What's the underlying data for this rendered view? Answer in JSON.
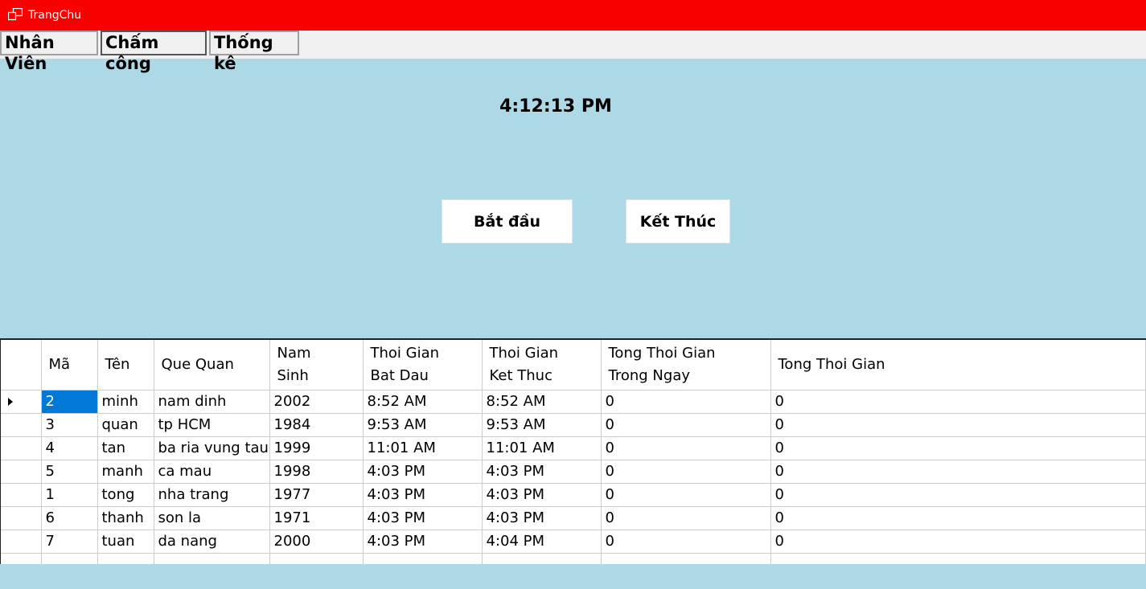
{
  "window": {
    "title": "TrangChu",
    "titlebar_color": "#F80000",
    "background_color": "#ADD8E6"
  },
  "menu": {
    "items": [
      "Nhân Viên",
      "Chấm công",
      "Thống kê"
    ],
    "active_index": 1
  },
  "clock": {
    "time": "4:12:13 PM"
  },
  "buttons": {
    "start_label": "Bắt đầu",
    "end_label": "Kết Thúc"
  },
  "grid": {
    "columns": [
      "Mã",
      "Tên",
      "Que Quan",
      "Nam Sinh",
      "Thoi Gian Bat Dau",
      "Thoi Gian Ket Thuc",
      "Tong Thoi Gian Trong Ngay",
      "Tong Thoi Gian"
    ],
    "rows": [
      [
        "2",
        "minh",
        "nam dinh",
        "2002",
        "8:52 AM",
        "8:52 AM",
        "0",
        "0"
      ],
      [
        "3",
        "quan",
        "tp HCM",
        "1984",
        "9:53 AM",
        "9:53 AM",
        "0",
        "0"
      ],
      [
        "4",
        "tan",
        "ba ria vung tau",
        "1999",
        "11:01 AM",
        "11:01 AM",
        "0",
        "0"
      ],
      [
        "5",
        "manh",
        "ca mau",
        "1998",
        "4:03 PM",
        "4:03 PM",
        "0",
        "0"
      ],
      [
        "1",
        "tong",
        "nha trang",
        "1977",
        "4:03 PM",
        "4:03 PM",
        "0",
        "0"
      ],
      [
        "6",
        "thanh",
        "son la",
        "1971",
        "4:03 PM",
        "4:03 PM",
        "0",
        "0"
      ],
      [
        "7",
        "tuan",
        "da nang",
        "2000",
        "4:03 PM",
        "4:04 PM",
        "0",
        "0"
      ]
    ],
    "selected_row": 0,
    "selected_color": "#0078D7"
  }
}
